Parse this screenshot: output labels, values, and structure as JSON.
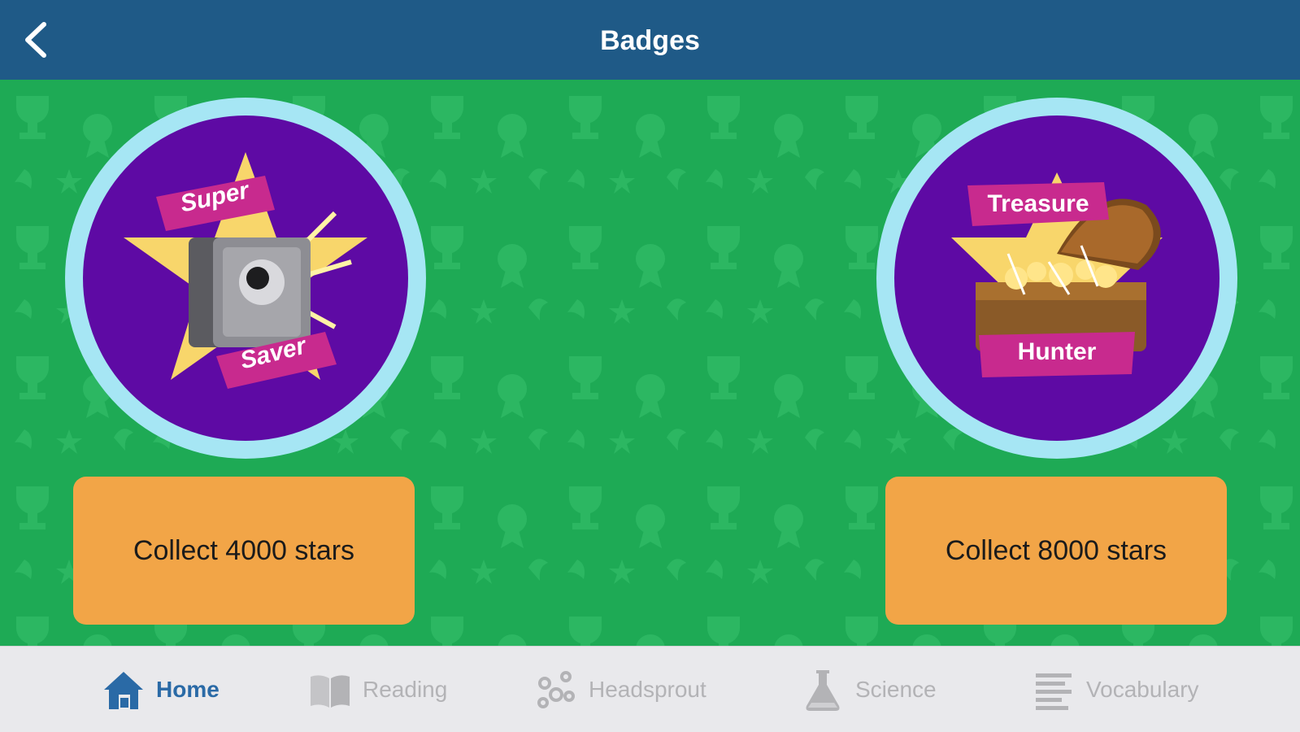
{
  "header": {
    "title": "Badges",
    "back_icon": "chevron-left-icon"
  },
  "badges": [
    {
      "banner_top": "Super",
      "banner_bottom": "Saver",
      "icon": "safe-icon",
      "requirement": "Collect 4000 stars"
    },
    {
      "banner_top": "Treasure",
      "banner_bottom": "Hunter",
      "icon": "treasure-chest-icon",
      "requirement": "Collect 8000 stars"
    }
  ],
  "tabs": [
    {
      "label": "Home",
      "icon": "home-icon",
      "active": true
    },
    {
      "label": "Reading",
      "icon": "book-icon",
      "active": false
    },
    {
      "label": "Headsprout",
      "icon": "headsprout-icon",
      "active": false
    },
    {
      "label": "Science",
      "icon": "flask-icon",
      "active": false
    },
    {
      "label": "Vocabulary",
      "icon": "list-icon",
      "active": false
    }
  ],
  "colors": {
    "header": "#1f5a87",
    "background": "#1eaa55",
    "badge_ring": "#a6e6f4",
    "badge_fill": "#5e0aa4",
    "banner": "#c82a8e",
    "star": "#f8d66b",
    "requirement_box": "#f2a547",
    "tab_active": "#2a6aa6",
    "tab_inactive": "#b3b3b6"
  }
}
